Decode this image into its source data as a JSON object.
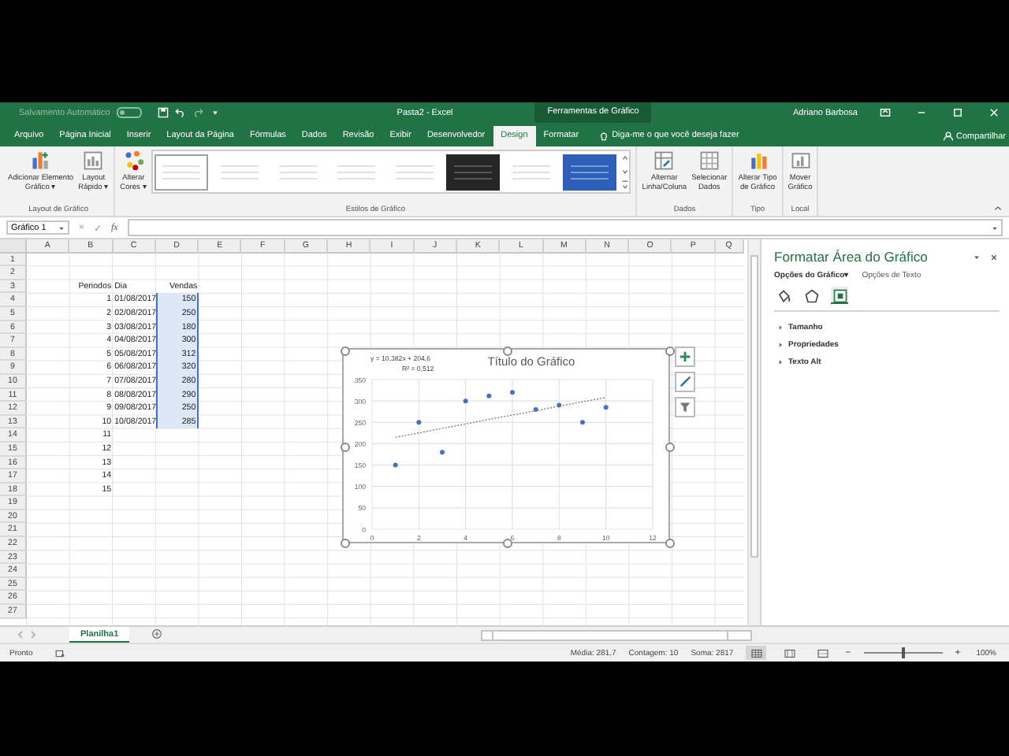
{
  "title_bar": {
    "autosave_label": "Salvamento Automático",
    "autosave_on": false,
    "document_title": "Pasta2 - Excel",
    "context_label": "Ferramentas de Gráfico",
    "user_name": "Adriano Barbosa"
  },
  "tabs": [
    {
      "label": "Arquivo",
      "selected": false
    },
    {
      "label": "Página Inicial",
      "selected": false
    },
    {
      "label": "Inserir",
      "selected": false
    },
    {
      "label": "Layout da Página",
      "selected": false
    },
    {
      "label": "Fórmulas",
      "selected": false
    },
    {
      "label": "Dados",
      "selected": false
    },
    {
      "label": "Revisão",
      "selected": false
    },
    {
      "label": "Exibir",
      "selected": false
    },
    {
      "label": "Desenvolvedor",
      "selected": false
    },
    {
      "label": "Design",
      "selected": true
    },
    {
      "label": "Formatar",
      "selected": false
    }
  ],
  "tell_me": "Diga-me o que você deseja fazer",
  "share": "Compartilhar",
  "ribbon": {
    "groups": [
      {
        "label": "Layout de Gráfico",
        "buttons": [
          {
            "kind": "add_element",
            "lines": [
              "Adicionar Elemento",
              "Gráfico ▾"
            ]
          },
          {
            "kind": "quick_layout",
            "lines": [
              "Layout",
              "Rápido ▾"
            ]
          }
        ]
      },
      {
        "label": "Estilos de Gráfico",
        "buttons": [
          {
            "kind": "colors",
            "lines": [
              "Alterar",
              "Cores ▾"
            ]
          }
        ],
        "styles": [
          {
            "kind": "light",
            "selected": true
          },
          {
            "kind": "light",
            "selected": false
          },
          {
            "kind": "light",
            "selected": false
          },
          {
            "kind": "light",
            "selected": false
          },
          {
            "kind": "light",
            "selected": false
          },
          {
            "kind": "dark",
            "selected": false
          },
          {
            "kind": "light",
            "selected": false
          },
          {
            "kind": "blue",
            "selected": false
          }
        ]
      },
      {
        "label": "Dados",
        "buttons": [
          {
            "kind": "switch",
            "lines": [
              "Alternar",
              "Linha/Coluna"
            ]
          },
          {
            "kind": "select_data",
            "lines": [
              "Selecionar",
              "Dados"
            ]
          }
        ]
      },
      {
        "label": "Tipo",
        "buttons": [
          {
            "kind": "change_type",
            "lines": [
              "Alterar Tipo",
              "de Gráfico"
            ]
          }
        ]
      },
      {
        "label": "Local",
        "buttons": [
          {
            "kind": "move",
            "lines": [
              "Mover",
              "Gráfico"
            ]
          }
        ]
      }
    ]
  },
  "formula_bar": {
    "name_box": "Gráfico 1",
    "cancel": "×",
    "enter": "✓",
    "function": "fx"
  },
  "sheet": {
    "columns": [
      "A",
      "B",
      "C",
      "D",
      "E",
      "F",
      "G",
      "H",
      "I",
      "J",
      "K",
      "L",
      "M",
      "N",
      "O",
      "P",
      "Q"
    ],
    "rows": [
      {
        "number": "1"
      },
      {
        "number": "2"
      },
      {
        "number": "3",
        "b": "Periodos",
        "c": "Dia",
        "d": {
          "text": "Vendas",
          "selected": false
        }
      },
      {
        "number": "4",
        "b": "1",
        "c": "01/08/2017",
        "d": {
          "text": "150",
          "selected": true
        }
      },
      {
        "number": "5",
        "b": "2",
        "c": "02/08/2017",
        "d": {
          "text": "250",
          "selected": true
        }
      },
      {
        "number": "6",
        "b": "3",
        "c": "03/08/2017",
        "d": {
          "text": "180",
          "selected": true
        }
      },
      {
        "number": "7",
        "b": "4",
        "c": "04/08/2017",
        "d": {
          "text": "300",
          "selected": true
        }
      },
      {
        "number": "8",
        "b": "5",
        "c": "05/08/2017",
        "d": {
          "text": "312",
          "selected": true
        }
      },
      {
        "number": "9",
        "b": "6",
        "c": "06/08/2017",
        "d": {
          "text": "320",
          "selected": true
        }
      },
      {
        "number": "10",
        "b": "7",
        "c": "07/08/2017",
        "d": {
          "text": "280",
          "selected": true
        }
      },
      {
        "number": "11",
        "b": "8",
        "c": "08/08/2017",
        "d": {
          "text": "290",
          "selected": true
        }
      },
      {
        "number": "12",
        "b": "9",
        "c": "09/08/2017",
        "d": {
          "text": "250",
          "selected": true
        }
      },
      {
        "number": "13",
        "b": "10",
        "c": "10/08/2017",
        "d": {
          "text": "285",
          "selected": true
        }
      },
      {
        "number": "14",
        "b": "11"
      },
      {
        "number": "15",
        "b": "12"
      },
      {
        "number": "16",
        "b": "13"
      },
      {
        "number": "17",
        "b": "14"
      },
      {
        "number": "18",
        "b": "15"
      },
      {
        "number": "19"
      },
      {
        "number": "20"
      },
      {
        "number": "21"
      },
      {
        "number": "22"
      },
      {
        "number": "23"
      },
      {
        "number": "24"
      },
      {
        "number": "25"
      },
      {
        "number": "26"
      },
      {
        "number": "27"
      }
    ],
    "chart": {
      "chart_data": {
        "type": "scatter",
        "title": "Título do Gráfico",
        "x": [
          1,
          2,
          3,
          4,
          5,
          6,
          7,
          8,
          9,
          10
        ],
        "series": [
          {
            "color": "#4472c4",
            "values": [
              150,
              250,
              180,
              300,
              312,
              320,
              280,
              290,
              250,
              285
            ]
          },
          {
            "type": "line",
            "line_style": "dotted",
            "color": "#7f7f7f",
            "values": [
              215,
              225,
              236,
              246,
              257,
              267,
              277,
              288,
              298,
              308
            ]
          }
        ],
        "grid": true,
        "xlim": [
          0,
          12
        ],
        "ylim": [
          0,
          350
        ],
        "xticks": [
          0,
          2,
          4,
          6,
          8,
          10,
          12
        ],
        "yticks": [
          0,
          50,
          100,
          150,
          200,
          250,
          300,
          350
        ],
        "annotations": [
          "y = 10,382x + 204,6",
          "R² = 0,512"
        ]
      }
    }
  },
  "pane": {
    "title": "Formatar Área do Gráfico",
    "option_tabs": [
      {
        "label": "Opções do Gráfico",
        "selected": true,
        "dropdown_mark": "▾"
      },
      {
        "label": "Opções de Texto",
        "selected": false
      }
    ],
    "icon_tabs": [
      {
        "kind": "fill",
        "selected": false
      },
      {
        "kind": "effects",
        "selected": false
      },
      {
        "kind": "size",
        "selected": true
      }
    ],
    "sections": [
      {
        "label": "Tamanho",
        "expanded": false
      },
      {
        "label": "Propriedades",
        "expanded": false
      },
      {
        "label": "Texto Alt",
        "expanded": false
      }
    ]
  },
  "sheet_tabs": [
    {
      "label": "Planilha1",
      "selected": true
    }
  ],
  "status_bar": {
    "ready": "Pronto",
    "average": "Média: 281,7",
    "count": "Contagem: 10",
    "sum": "Soma: 2817",
    "views": [
      {
        "kind": "normal",
        "selected": true
      },
      {
        "kind": "page_layout",
        "selected": false
      },
      {
        "kind": "page_break",
        "selected": false
      }
    ],
    "zoom_out": "−",
    "zoom_in": "+",
    "zoom": {
      "level": 0.5
    },
    "zoom_text": "100%"
  }
}
